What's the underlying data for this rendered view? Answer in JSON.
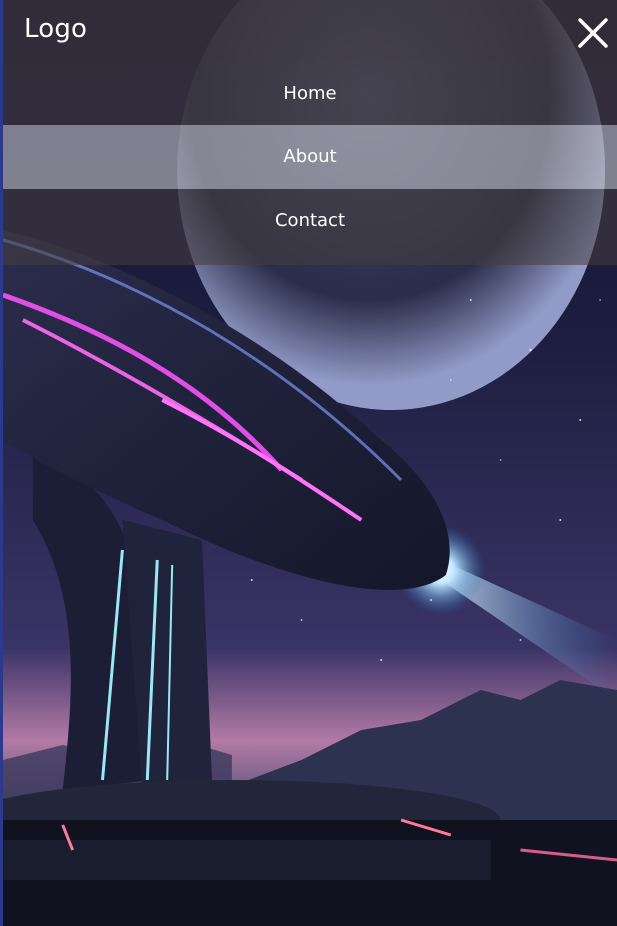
{
  "header": {
    "logo_text": "Logo",
    "close_icon": "close-icon"
  },
  "nav": {
    "items": [
      {
        "label": "Home",
        "active": false
      },
      {
        "label": "About",
        "active": true
      },
      {
        "label": "Contact",
        "active": false
      }
    ]
  },
  "colors": {
    "menu_overlay": "#463e3e",
    "active_item": "#bebec3",
    "text": "#ffffff"
  },
  "background": {
    "image": "sci-fi-spaceship-on-pedestal-with-planet"
  }
}
